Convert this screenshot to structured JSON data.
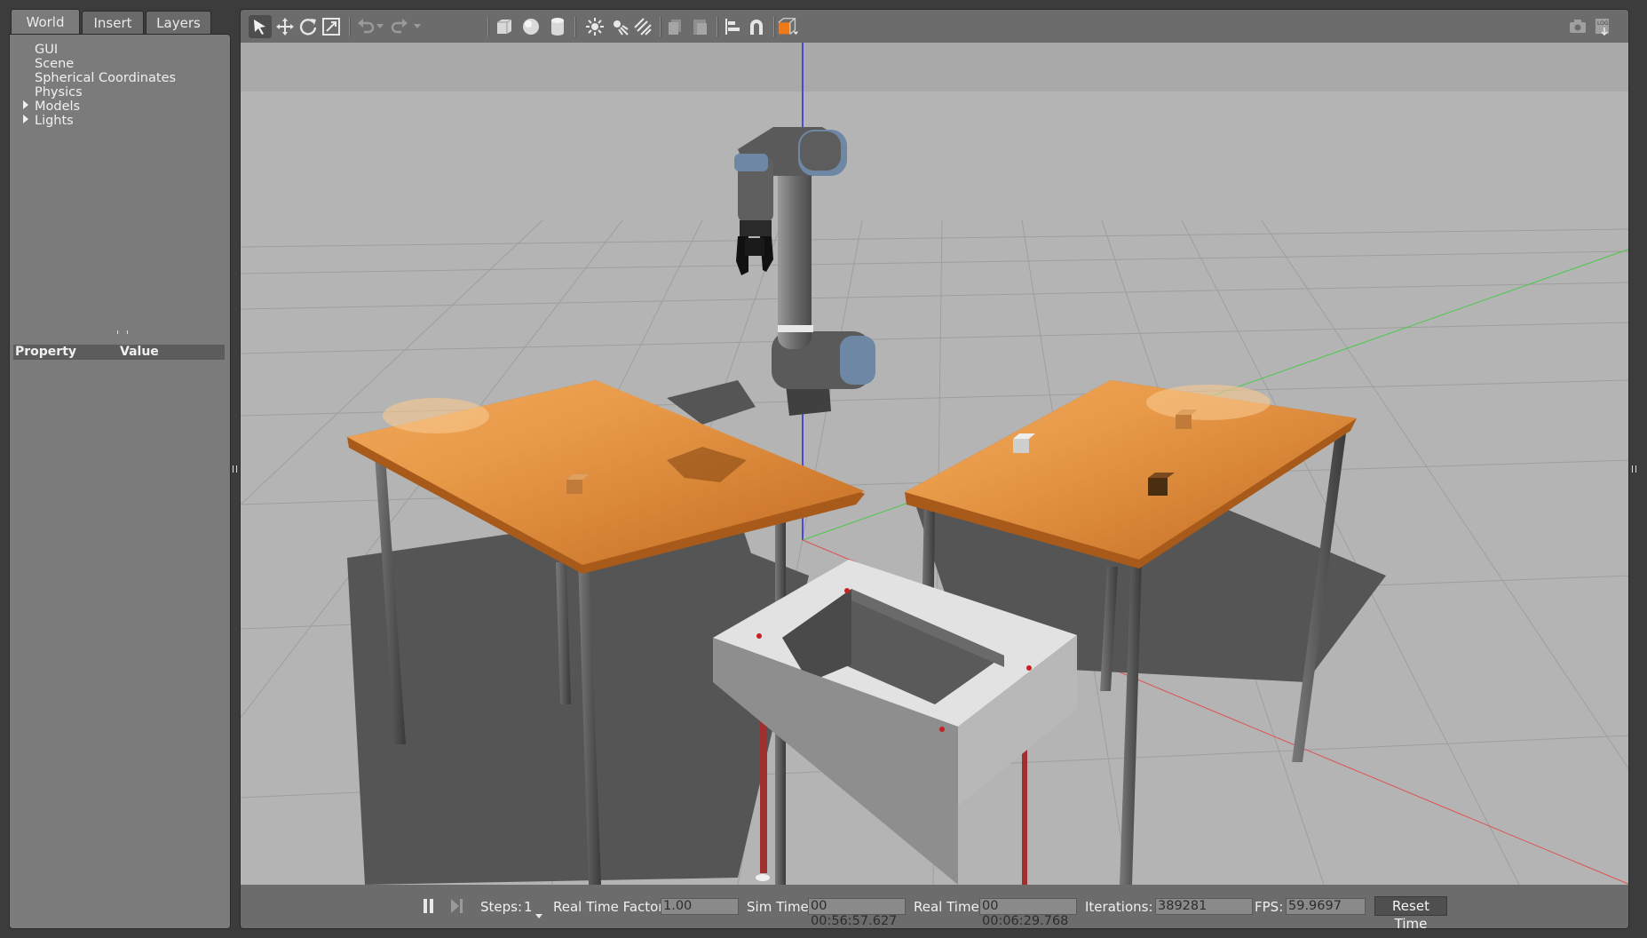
{
  "left_panel": {
    "tabs": [
      {
        "label": "World",
        "active": true
      },
      {
        "label": "Insert",
        "active": false
      },
      {
        "label": "Layers",
        "active": false
      }
    ],
    "tree": [
      {
        "label": "GUI",
        "expandable": false
      },
      {
        "label": "Scene",
        "expandable": false
      },
      {
        "label": "Spherical Coordinates",
        "expandable": false
      },
      {
        "label": "Physics",
        "expandable": false
      },
      {
        "label": "Models",
        "expandable": true
      },
      {
        "label": "Lights",
        "expandable": true
      }
    ],
    "property_header": {
      "property": "Property",
      "value": "Value"
    }
  },
  "toolbar": {
    "icons": [
      "select-arrow-icon",
      "translate-icon",
      "rotate-icon",
      "scale-icon",
      "undo-icon",
      "undo-dropdown-icon",
      "redo-icon",
      "redo-dropdown-icon",
      "box-shape-icon",
      "sphere-shape-icon",
      "cylinder-shape-icon",
      "point-light-icon",
      "spot-light-icon",
      "directional-light-icon",
      "copy-icon",
      "paste-icon",
      "align-icon",
      "snap-magnet-icon",
      "view-angle-icon",
      "screenshot-icon",
      "log-icon"
    ],
    "accent_color": "#f07a1a"
  },
  "bottom_bar": {
    "steps_label": "Steps:",
    "steps_value": "1",
    "rtf_label": "Real Time Factor:",
    "rtf_value": "1.00",
    "sim_time_label": "Sim Time:",
    "sim_time_value": "00 00:56:57.627",
    "real_time_label": "Real Time:",
    "real_time_value": "00 00:06:29.768",
    "iterations_label": "Iterations:",
    "iterations_value": "389281",
    "fps_label": "FPS:",
    "fps_value": "59.9697",
    "reset_label": "Reset Time"
  },
  "scene": {
    "background_color": "#b3b3b3",
    "sky_color": "#a8a8a8",
    "objects": [
      "robot-arm",
      "left-table",
      "right-table",
      "bin",
      "cube-left-table",
      "cube-right-gray",
      "cube-right-brown",
      "cube-right-dark"
    ]
  }
}
